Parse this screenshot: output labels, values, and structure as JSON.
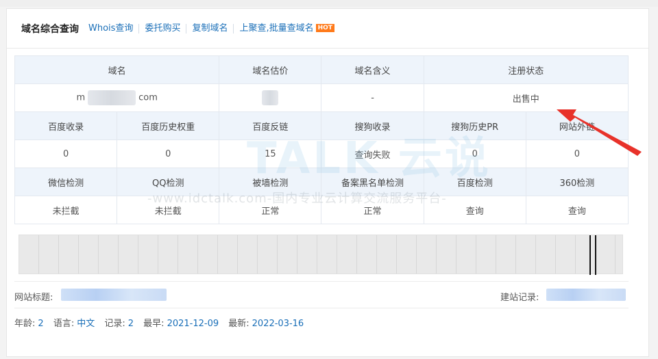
{
  "tabs": {
    "title": "域名综合查询",
    "links": [
      "Whois查询",
      "委托购买",
      "复制域名",
      "上聚查,批量查域名"
    ],
    "hot": "HOT"
  },
  "table": {
    "row1_headers": [
      "域名",
      "域名估价",
      "域名含义",
      "注册状态"
    ],
    "row1_values": {
      "domain_prefix": "m",
      "domain_suffix": "com",
      "meaning": "-",
      "status": "出售中"
    },
    "row2_headers": [
      "百度收录",
      "百度历史权重",
      "百度反链",
      "搜狗收录",
      "搜狗历史PR",
      "网站外链"
    ],
    "row2_values": [
      "0",
      "0",
      "15",
      "查询失败",
      "0",
      "0"
    ],
    "row3_headers": [
      "微信检测",
      "QQ检测",
      "被墙检测",
      "备案黑名单检测",
      "百度检测",
      "360检测"
    ],
    "row3_values": [
      "未拦截",
      "未拦截",
      "正常",
      "正常",
      "查询",
      "查询"
    ]
  },
  "info": {
    "site_title_label": "网站标题:",
    "build_record_label": "建站记录:"
  },
  "stats": {
    "age_label": "年龄:",
    "age": "2",
    "lang_label": "语言:",
    "lang": "中文",
    "records_label": "记录:",
    "records": "2",
    "earliest_label": "最早:",
    "earliest": "2021-12-09",
    "latest_label": "最新:",
    "latest": "2022-03-16"
  },
  "watermark": {
    "line": "-www.idctalk.com-国内专业云计算交流服务平台-",
    "brand": "TALK 云说"
  },
  "colors": {
    "link": "#1a6fb8",
    "ok": "#1f8a1f",
    "arrow": "#e8322a",
    "hot": "#ff7a1a"
  }
}
